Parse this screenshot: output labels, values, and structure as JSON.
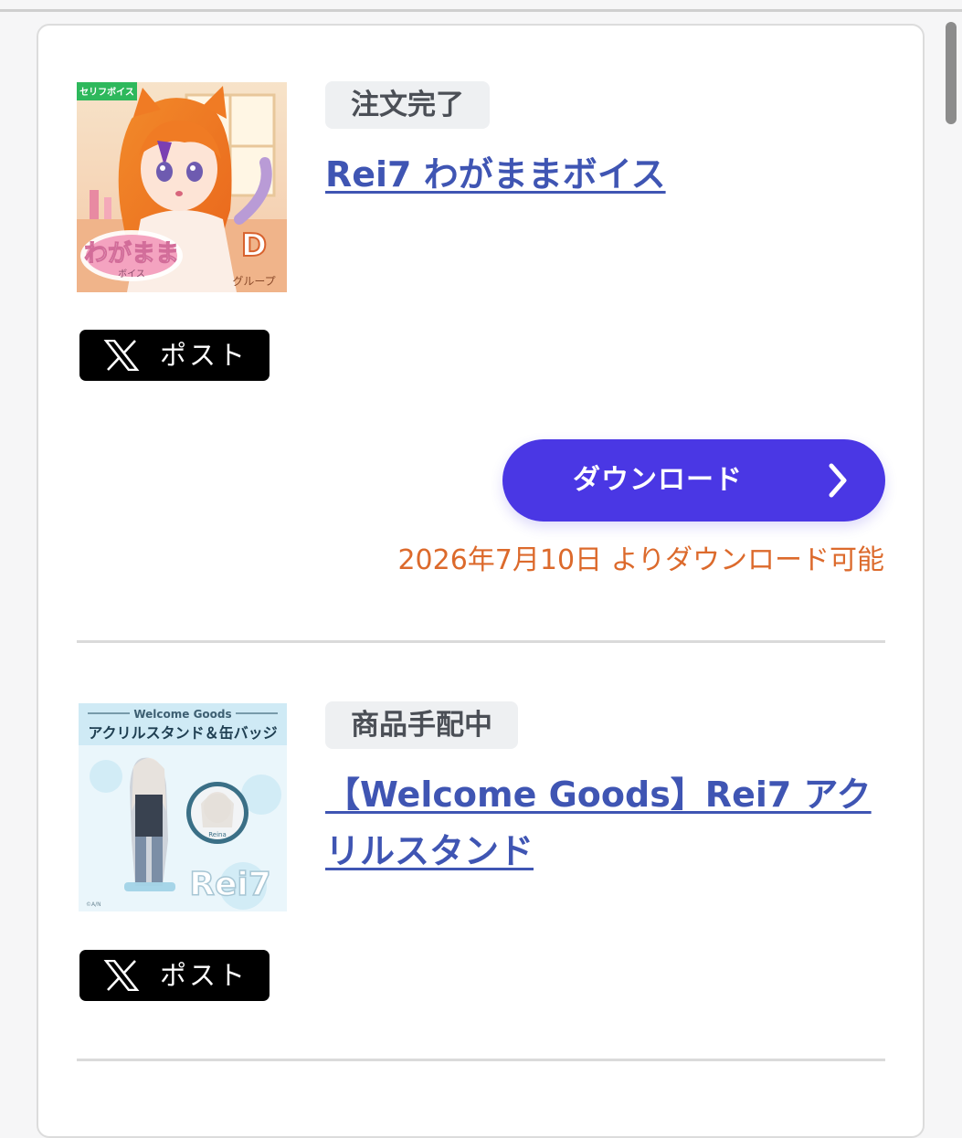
{
  "orders": [
    {
      "status": "注文完了",
      "title": "Rei7 わがままボイス",
      "thumbnail": {
        "tag": "セリフボイス",
        "logo_text": "わがまま",
        "logo_sub": "ボイス",
        "group_letter": "D",
        "group_label": "グループ"
      },
      "post_label": "ポスト",
      "download_label": "ダウンロード",
      "availability": "2026年7月10日 よりダウンロード可能"
    },
    {
      "status": "商品手配中",
      "title": "【Welcome Goods】Rei7 アクリルスタンド",
      "thumbnail": {
        "header": "Welcome Goods",
        "subheader": "アクリルスタンド＆缶バッジ",
        "brand": "Rei7",
        "badge_name": "Reina",
        "credit": "©A/N"
      },
      "post_label": "ポスト"
    }
  ],
  "colors": {
    "accent": "#4a37e4",
    "link": "#3f55b3",
    "note": "#dc6a2c",
    "badge_bg": "#eef0f2"
  },
  "icons": {
    "social": "x-logo-icon",
    "next": "chevron-right-icon"
  }
}
